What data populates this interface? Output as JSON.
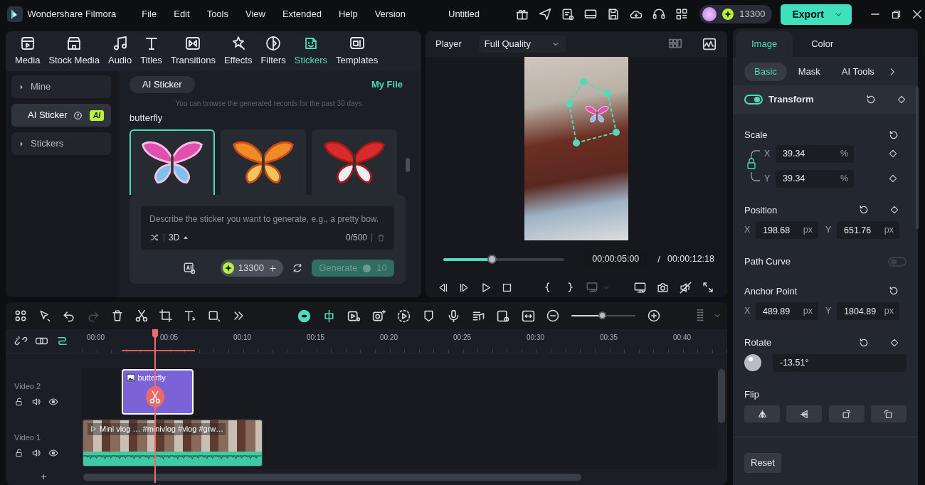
{
  "app": {
    "name": "Wondershare Filmora",
    "menu": [
      "File",
      "Edit",
      "Tools",
      "View",
      "Extended",
      "Help",
      "Version"
    ],
    "project_title": "Untitled",
    "credits": "13300",
    "export_label": "Export"
  },
  "media_tabs": [
    {
      "label": "Media",
      "selected": false
    },
    {
      "label": "Stock Media",
      "selected": false
    },
    {
      "label": "Audio",
      "selected": false
    },
    {
      "label": "Titles",
      "selected": false
    },
    {
      "label": "Transitions",
      "selected": false
    },
    {
      "label": "Effects",
      "selected": false
    },
    {
      "label": "Filters",
      "selected": false
    },
    {
      "label": "Stickers",
      "selected": true
    },
    {
      "label": "Templates",
      "selected": false
    }
  ],
  "sticker_sidebar": [
    {
      "label": "Mine",
      "kind": "folder",
      "selected": false
    },
    {
      "label": "AI Sticker",
      "kind": "ai",
      "selected": true,
      "badge": "AI"
    },
    {
      "label": "Stickers",
      "kind": "folder",
      "selected": false
    }
  ],
  "sticker_panel": {
    "tab": "AI Sticker",
    "my_file": "My File",
    "hint": "You can browse the generated records for the past 30 days.",
    "group": "butterfly",
    "stickers": [
      {
        "selected": true
      },
      {
        "selected": false
      },
      {
        "selected": false
      }
    ]
  },
  "prompt": {
    "placeholder": "Describe the sticker you want to generate, e.g., a pretty bow.",
    "style": "3D",
    "counter": "0/500",
    "credits": "13300",
    "generate": "Generate",
    "cost": "10",
    "disabled": true
  },
  "player": {
    "label": "Player",
    "quality": "Full Quality",
    "progress": {
      "level": 0.4
    },
    "current_time": "00:00:05:00",
    "separator": "/",
    "total_time": "00:00:12:18"
  },
  "inspector": {
    "tabs": [
      {
        "label": "Image",
        "selected": true
      },
      {
        "label": "Color",
        "selected": false
      }
    ],
    "subtabs": [
      {
        "label": "Basic",
        "selected": true
      },
      {
        "label": "Mask",
        "selected": false
      },
      {
        "label": "AI Tools",
        "selected": false
      }
    ],
    "transform": {
      "label": "Transform",
      "on": true
    },
    "scale": {
      "label": "Scale",
      "fields": [
        {
          "axis": "X",
          "value": "39.34",
          "unit": "%"
        },
        {
          "axis": "Y",
          "value": "39.34",
          "unit": "%"
        }
      ]
    },
    "position": {
      "label": "Position",
      "fields": [
        {
          "axis": "X",
          "value": "198.68",
          "unit": "px"
        },
        {
          "axis": "Y",
          "value": "651.76",
          "unit": "px"
        }
      ]
    },
    "path_curve": {
      "label": "Path Curve",
      "on": false
    },
    "anchor": {
      "label": "Anchor Point",
      "fields": [
        {
          "axis": "X",
          "value": "489.89",
          "unit": "px"
        },
        {
          "axis": "Y",
          "value": "1804.89",
          "unit": "px"
        }
      ]
    },
    "rotate": {
      "label": "Rotate",
      "value": "-13.51°"
    },
    "flip_label": "Flip",
    "reset": "Reset"
  },
  "timeline": {
    "zoom": {
      "level": 0.48
    },
    "ruler": [
      "00:00",
      "00:05",
      "00:10",
      "00:15",
      "00:20",
      "00:25",
      "00:30",
      "00:35",
      "00:40"
    ],
    "tracks": [
      {
        "name": "Video 2",
        "clips": [
          {
            "label": "butterfly",
            "kind": "image",
            "selected": true
          }
        ]
      },
      {
        "name": "Video 1",
        "clips": [
          {
            "label": "Mini vlog … #minivlog #vlog #grw…",
            "kind": "video",
            "selected": false
          }
        ]
      }
    ]
  }
}
